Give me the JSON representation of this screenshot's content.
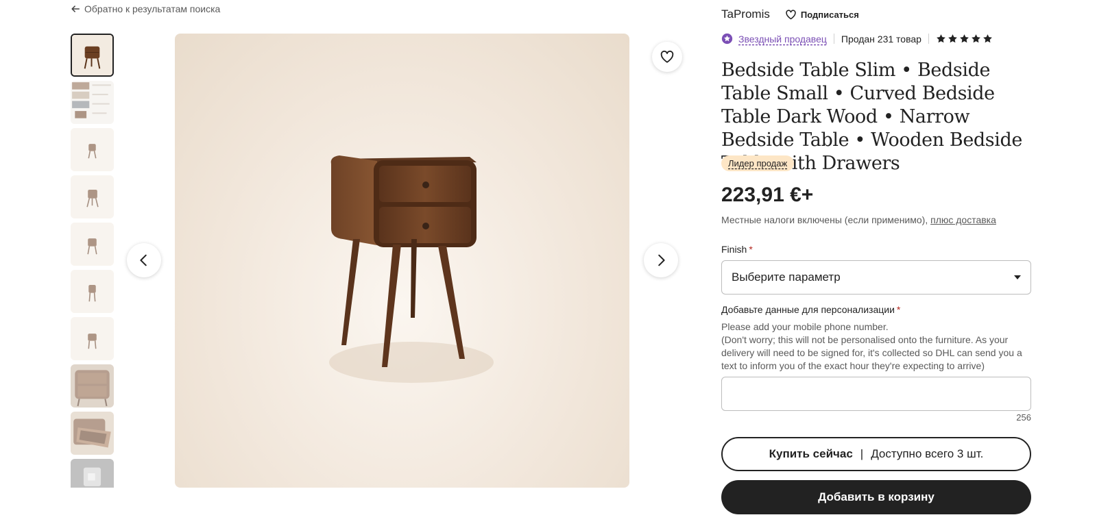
{
  "nav": {
    "back_label": "Обратно к результатам поиска"
  },
  "gallery": {
    "thumbnails": [
      "thumb-1",
      "thumb-2",
      "thumb-3",
      "thumb-4",
      "thumb-5",
      "thumb-6",
      "thumb-7",
      "thumb-8",
      "thumb-9",
      "thumb-10"
    ],
    "active_index": 0
  },
  "shop": {
    "name": "TaPromis",
    "follow_label": "Подписаться",
    "star_seller_label": "Звездный продавец",
    "sold_label": "Продан 231 товар",
    "rating_stars": 5
  },
  "product": {
    "title": "Bedside Table Slim • Bedside Table Small • Curved Bedside Table Dark Wood • Narrow Bedside Table • Wooden Bedside Table with Drawers",
    "badge": "Лидер продаж",
    "price": "223,91 €+",
    "tax_note": "Местные налоги включены (если применимо),",
    "shipping_link": "плюс доставка"
  },
  "options": {
    "finish_label": "Finish",
    "finish_placeholder": "Выберите параметр",
    "personalization_label": "Добавьте данные для персонализации",
    "personalization_line1": "Please add your mobile phone number.",
    "personalization_line2": "(Don't worry; this will not be personalised onto the furniture. As your delivery will need to be signed for, it's collected so DHL can send you a text to inform you of the exact hour they're expecting to arrive)",
    "char_counter": "256",
    "required_mark": "*"
  },
  "actions": {
    "buy_now_label": "Купить сейчас",
    "separator": "|",
    "availability": "Доступно всего 3 шт.",
    "add_to_cart_label": "Добавить в корзину"
  },
  "colors": {
    "star_seller": "#7b4fb5",
    "badge_bg": "#fde6c6",
    "required": "#b3261e",
    "dark_button": "#222222",
    "wood": "#6b3f22"
  }
}
